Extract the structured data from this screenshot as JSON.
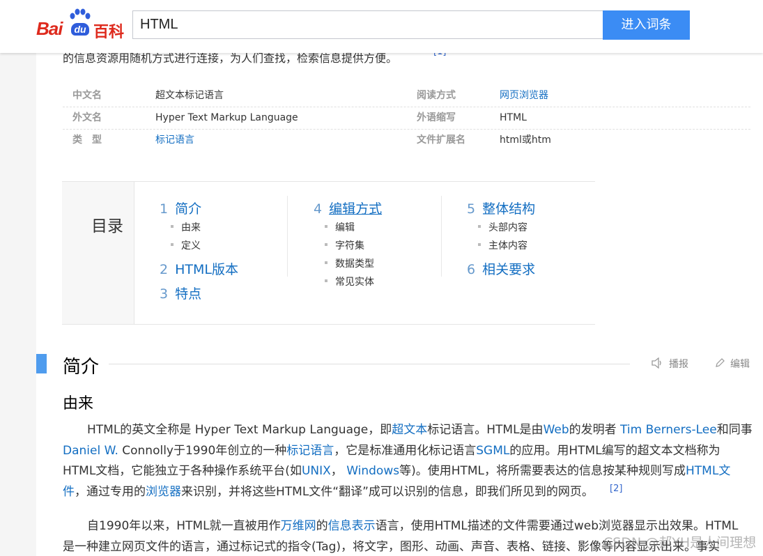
{
  "header": {
    "logo": {
      "bai": "Bai",
      "du": "du",
      "baike": "百科"
    },
    "search": {
      "value": "HTML"
    },
    "enter_button": "进入词条"
  },
  "intro_partial": {
    "text": "的信息资源用随机方式进行连接，为人们查找，检索信息提供方便。",
    "ref": "[1]"
  },
  "infobox": [
    {
      "k1": "中文名",
      "v1": "超文本标记语言",
      "k2": "阅读方式",
      "v2": "网页浏览器"
    },
    {
      "k1": "外文名",
      "v1": "Hyper Text Markup Language",
      "k2": "外语缩写",
      "v2": "HTML"
    },
    {
      "k1": "类　型",
      "v1": "标记语言",
      "k2": "文件扩展名",
      "v2": "html或htm"
    }
  ],
  "catalog": {
    "title": "目录",
    "items": [
      {
        "num": "1",
        "label": "简介",
        "subs": [
          "由来",
          "定义"
        ]
      },
      {
        "num": "2",
        "label": "HTML版本"
      },
      {
        "num": "3",
        "label": "特点"
      },
      {
        "num": "4",
        "label": "编辑方式",
        "subs": [
          "编辑",
          "字符集",
          "数据类型",
          "常见实体"
        ]
      },
      {
        "num": "5",
        "label": "整体结构",
        "subs": [
          "头部内容",
          "主体内容"
        ]
      },
      {
        "num": "6",
        "label": "相关要求"
      }
    ]
  },
  "section": {
    "title": "简介",
    "play_label": "播报",
    "edit_label": "编辑",
    "subtitle": "由来",
    "p1": {
      "l1": [
        "HTML的英文全称是 Hyper Text Markup Language，即",
        "超文本",
        "标记语言。HTML是由",
        "Web",
        "的发明者 ",
        "Tim Berners-Lee",
        "和同事"
      ],
      "l2": [
        "Daniel W.",
        " Connolly于1990年创立的一种",
        "标记语言",
        "，它是标准通用化标记语言",
        "SGML",
        "的应用。用HTML编写的超文本文档称为"
      ],
      "l3": [
        "HTML文档，它能独立于各种操作系统平台(如",
        "UNIX",
        "， ",
        "Windows",
        "等)。使用HTML，将所需要表达的信息按某种规则写成",
        "HTML文"
      ],
      "l4": [
        "件",
        "，通过专用的",
        "浏览器",
        "来识别，并将这些HTML文件“翻译”成可以识别的信息，即我们所见到的网页。"
      ],
      "ref": "[2]"
    },
    "p2": {
      "l1": [
        "自1990年以来，HTML就一直被用作",
        "万维网",
        "的",
        "信息表示",
        "语言，使用HTML描述的文件需要通过web浏览器显示出效果。HTML"
      ],
      "l2": [
        "是一种建立网页文件的语言，通过标记式的指令(Tag)，将文字，图形、动画、声音、表格、链接、影像等内容显示出来。事实"
      ]
    }
  },
  "watermark": "CSDN @郝YH是人间理想"
}
